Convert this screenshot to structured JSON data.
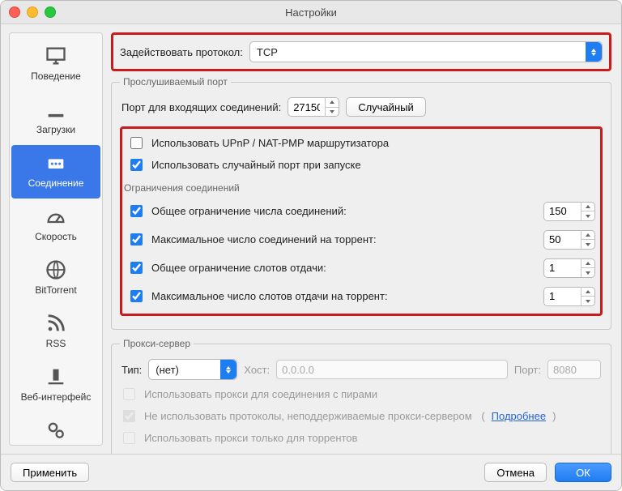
{
  "window": {
    "title": "Настройки"
  },
  "sidebar": {
    "items": [
      {
        "label": "Поведение"
      },
      {
        "label": "Загрузки"
      },
      {
        "label": "Соединение"
      },
      {
        "label": "Скорость"
      },
      {
        "label": "BitTorrent"
      },
      {
        "label": "RSS"
      },
      {
        "label": "Веб-интерфейс"
      },
      {
        "label": ""
      }
    ],
    "active_index": 2
  },
  "protocol": {
    "label": "Задействовать протокол:",
    "value": "TCP"
  },
  "listening_port": {
    "legend": "Прослушиваемый порт",
    "incoming_label": "Порт для входящих соединений:",
    "incoming_value": "27150",
    "random_button": "Случайный",
    "upnp": {
      "label": "Использовать UPnP / NAT-PMP маршрутизатора",
      "checked": false
    },
    "random_on_start": {
      "label": "Использовать случайный порт при запуске",
      "checked": true
    }
  },
  "conn_limits": {
    "legend": "Ограничения соединений",
    "global_conn": {
      "label": "Общее ограничение числа соединений:",
      "checked": true,
      "value": "150"
    },
    "per_torrent_conn": {
      "label": "Максимальное число соединений на торрент:",
      "checked": true,
      "value": "50"
    },
    "global_upload": {
      "label": "Общее ограничение слотов отдачи:",
      "checked": true,
      "value": "1"
    },
    "per_torrent_upload": {
      "label": "Максимальное число слотов отдачи на торрент:",
      "checked": true,
      "value": "1"
    }
  },
  "proxy": {
    "legend": "Прокси-сервер",
    "type_label": "Тип:",
    "type_value": "(нет)",
    "host_label": "Хост:",
    "host_value": "0.0.0.0",
    "port_label": "Порт:",
    "port_value": "8080",
    "use_for_peers": {
      "label": "Использовать прокси для соединения с пирами",
      "checked": false,
      "disabled": true
    },
    "disable_unsupported": {
      "label": "Не использовать протоколы, неподдерживаемые прокси-сервером",
      "checked": true,
      "disabled": true,
      "more": "Подробнее"
    },
    "torrents_only": {
      "label": "Использовать прокси только для торрентов",
      "checked": false,
      "disabled": true
    }
  },
  "footer": {
    "apply": "Применить",
    "cancel": "Отмена",
    "ok": "ОК"
  }
}
